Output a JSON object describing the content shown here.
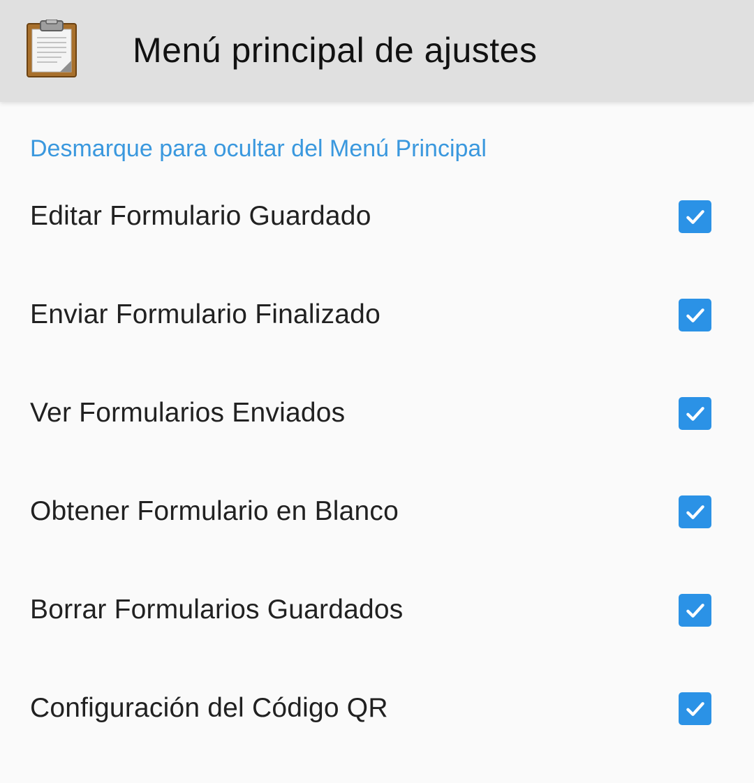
{
  "app_bar": {
    "title": "Menú principal de ajustes",
    "icon": "clipboard-icon"
  },
  "preferences": {
    "section_header": "Desmarque para ocultar del Menú Principal",
    "items": [
      {
        "label": "Editar Formulario Guardado",
        "checked": true
      },
      {
        "label": "Enviar Formulario Finalizado",
        "checked": true
      },
      {
        "label": "Ver Formularios Enviados",
        "checked": true
      },
      {
        "label": "Obtener Formulario en Blanco",
        "checked": true
      },
      {
        "label": "Borrar Formularios Guardados",
        "checked": true
      },
      {
        "label": "Configuración del Código QR",
        "checked": true
      }
    ]
  },
  "colors": {
    "app_bar_background": "#e0e0e0",
    "page_background": "#fafafa",
    "accent": "#2b92e6",
    "section_header": "#3a98de"
  }
}
